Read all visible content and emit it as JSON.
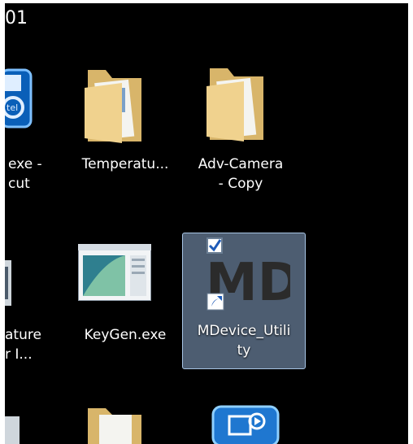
{
  "desktop": {
    "partial_top_text": "01",
    "icons": [
      {
        "label_line1": "exe -",
        "label_line2": "cut",
        "icon": "exe-shortcut-icon"
      },
      {
        "label_line1": "Temperatu...",
        "label_line2": "",
        "icon": "folder-icon"
      },
      {
        "label_line1": "Adv-Camera",
        "label_line2": "- Copy",
        "icon": "folder-icon"
      },
      {
        "label_line1": "ature",
        "label_line2": "r I...",
        "icon": "app-icon"
      },
      {
        "label_line1": "KeyGen.exe",
        "label_line2": "",
        "icon": "application-window-icon"
      },
      {
        "label_line1": "MDevice_Utili",
        "label_line2": "ty",
        "icon": "mdevice-utility-icon",
        "selected": true
      }
    ],
    "md_logo_text": "MD"
  }
}
